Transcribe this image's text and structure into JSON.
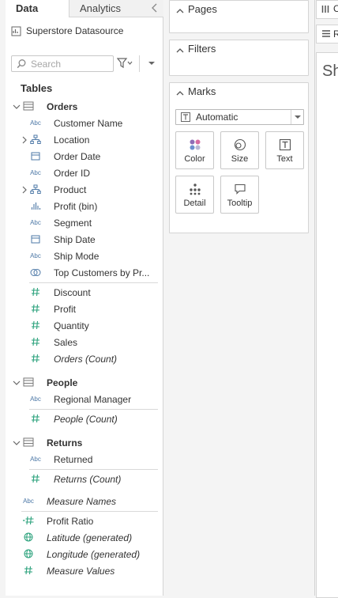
{
  "data_pane": {
    "tabs": {
      "data": "Data",
      "analytics": "Analytics"
    },
    "datasource": "Superstore Datasource",
    "search": {
      "placeholder": "Search",
      "value": ""
    },
    "tables_header": "Tables",
    "tables": [
      {
        "name": "Orders",
        "fields": [
          {
            "label": "Customer Name",
            "icon": "abc-icon",
            "expandable": false,
            "italic": false
          },
          {
            "label": "Location",
            "icon": "hierarchy-icon",
            "expandable": true,
            "italic": false
          },
          {
            "label": "Order Date",
            "icon": "calendar-icon",
            "expandable": false,
            "italic": false
          },
          {
            "label": "Order ID",
            "icon": "abc-icon",
            "expandable": false,
            "italic": false
          },
          {
            "label": "Product",
            "icon": "hierarchy-icon",
            "expandable": true,
            "italic": false
          },
          {
            "label": "Profit (bin)",
            "icon": "bin-icon",
            "expandable": false,
            "italic": false
          },
          {
            "label": "Segment",
            "icon": "abc-icon",
            "expandable": false,
            "italic": false
          },
          {
            "label": "Ship Date",
            "icon": "calendar-icon",
            "expandable": false,
            "italic": false
          },
          {
            "label": "Ship Mode",
            "icon": "abc-icon",
            "expandable": false,
            "italic": false
          },
          {
            "label": "Top Customers by Pr...",
            "icon": "set-icon",
            "expandable": false,
            "italic": false
          }
        ],
        "measures": [
          {
            "label": "Discount",
            "italic": false
          },
          {
            "label": "Profit",
            "italic": false
          },
          {
            "label": "Quantity",
            "italic": false
          },
          {
            "label": "Sales",
            "italic": false
          },
          {
            "label": "Orders (Count)",
            "italic": true
          }
        ]
      },
      {
        "name": "People",
        "fields": [
          {
            "label": "Regional Manager",
            "icon": "abc-icon"
          }
        ],
        "measures": [
          {
            "label": "People (Count)",
            "italic": true
          }
        ]
      },
      {
        "name": "Returns",
        "fields": [
          {
            "label": "Returned",
            "icon": "abc-icon"
          }
        ],
        "measures": [
          {
            "label": "Returns (Count)",
            "italic": true
          }
        ]
      }
    ],
    "extra_fields": [
      {
        "label": "Measure Names",
        "icon": "abc-icon",
        "italic": true
      },
      {
        "label": "Profit Ratio",
        "icon": "calc-number-icon",
        "italic": false
      },
      {
        "label": "Latitude (generated)",
        "icon": "globe-icon",
        "italic": true
      },
      {
        "label": "Longitude (generated)",
        "icon": "globe-icon",
        "italic": true
      },
      {
        "label": "Measure Values",
        "icon": "number-icon",
        "italic": true
      }
    ]
  },
  "cards": {
    "pages": "Pages",
    "filters": "Filters",
    "marks": "Marks",
    "mark_type": "Automatic",
    "mark_buttons": [
      "Color",
      "Size",
      "Text",
      "Detail",
      "Tooltip"
    ]
  },
  "right": {
    "columns_shelf": "C",
    "rows_shelf": "R",
    "sheet_title": "Sh"
  },
  "colors": {
    "dimension": "#4e79a7",
    "measure": "#2aa17b",
    "text": "#333333"
  }
}
